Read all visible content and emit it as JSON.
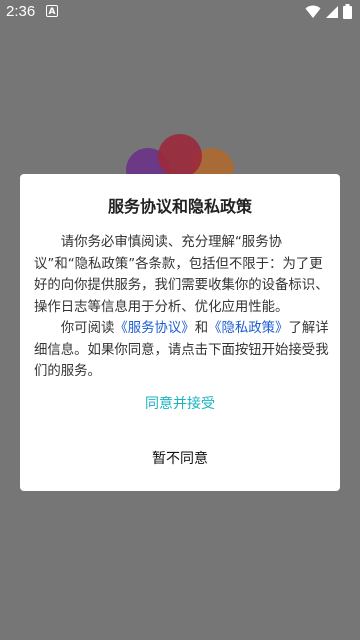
{
  "status_bar": {
    "time": "2:36",
    "notification_glyph": "A",
    "icons": [
      "wifi-icon",
      "signal-icon",
      "battery-icon"
    ]
  },
  "dialog": {
    "title": "服务协议和隐私政策",
    "paragraph1": "请你务必审慎阅读、充分理解“服务协议”和“隐私政策”各条款，包括但不限于：为了更好的向你提供服务，我们需要收集你的设备标识、操作日志等信息用于分析、优化应用性能。",
    "paragraph2_prefix": "你可阅读",
    "service_link": "《服务协议》",
    "and_text": "和",
    "privacy_link": "《隐私政策》",
    "paragraph2_suffix": "了解详细信息。如果你同意，请点击下面按钮开始接受我们的服务。",
    "accept_label": "同意并接受",
    "decline_label": "暂不同意"
  },
  "colors": {
    "overlay": "#767676",
    "link": "#1d5fd1",
    "accept": "#1ab3c4",
    "logo": [
      "#6a2f8a",
      "#9b2a3c",
      "#b26a2e"
    ]
  }
}
